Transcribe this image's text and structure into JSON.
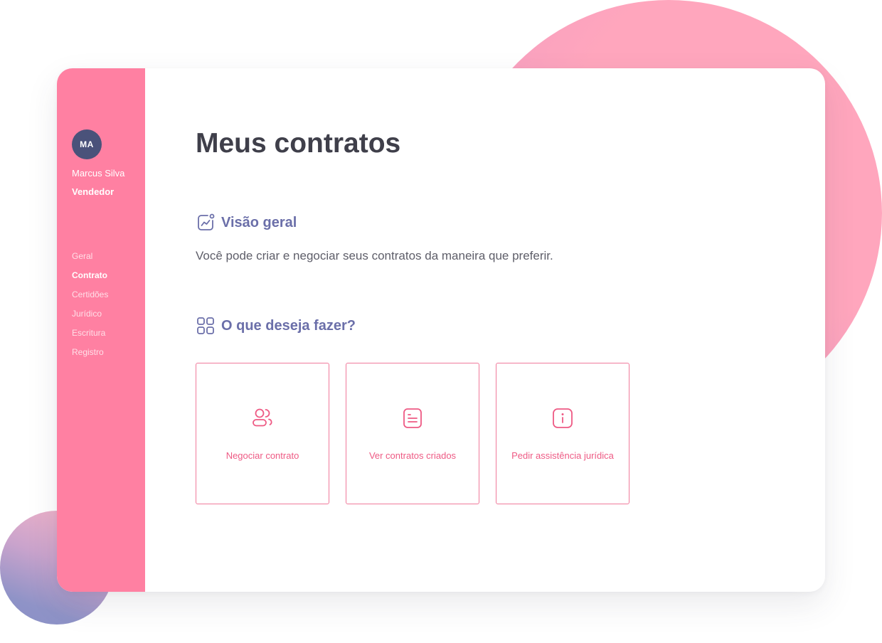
{
  "user": {
    "initials": "MA",
    "name": "Marcus Silva",
    "role": "Vendedor"
  },
  "nav": {
    "items": [
      {
        "label": "Geral",
        "active": false
      },
      {
        "label": "Contrato",
        "active": true
      },
      {
        "label": "Certidões",
        "active": false
      },
      {
        "label": "Jurídico",
        "active": false
      },
      {
        "label": "Escritura",
        "active": false
      },
      {
        "label": "Registro",
        "active": false
      }
    ]
  },
  "page": {
    "title": "Meus contratos"
  },
  "overview": {
    "icon": "chart-icon",
    "heading": "Visão geral",
    "description": "Você pode criar e negociar seus contratos da maneira que preferir."
  },
  "actions": {
    "icon": "grid-icon",
    "heading": "O que deseja fazer?",
    "cards": [
      {
        "label": "Negociar contrato",
        "icon": "users-icon"
      },
      {
        "label": "Ver contratos criados",
        "icon": "document-icon"
      },
      {
        "label": "Pedir assistência jurídica",
        "icon": "info-icon"
      }
    ]
  },
  "colors": {
    "sidebar": "#ff80a2",
    "accent": "#ee5a84",
    "heading_accent": "#6b6fa9",
    "title": "#3f3f4a",
    "avatar": "#4a527a"
  }
}
